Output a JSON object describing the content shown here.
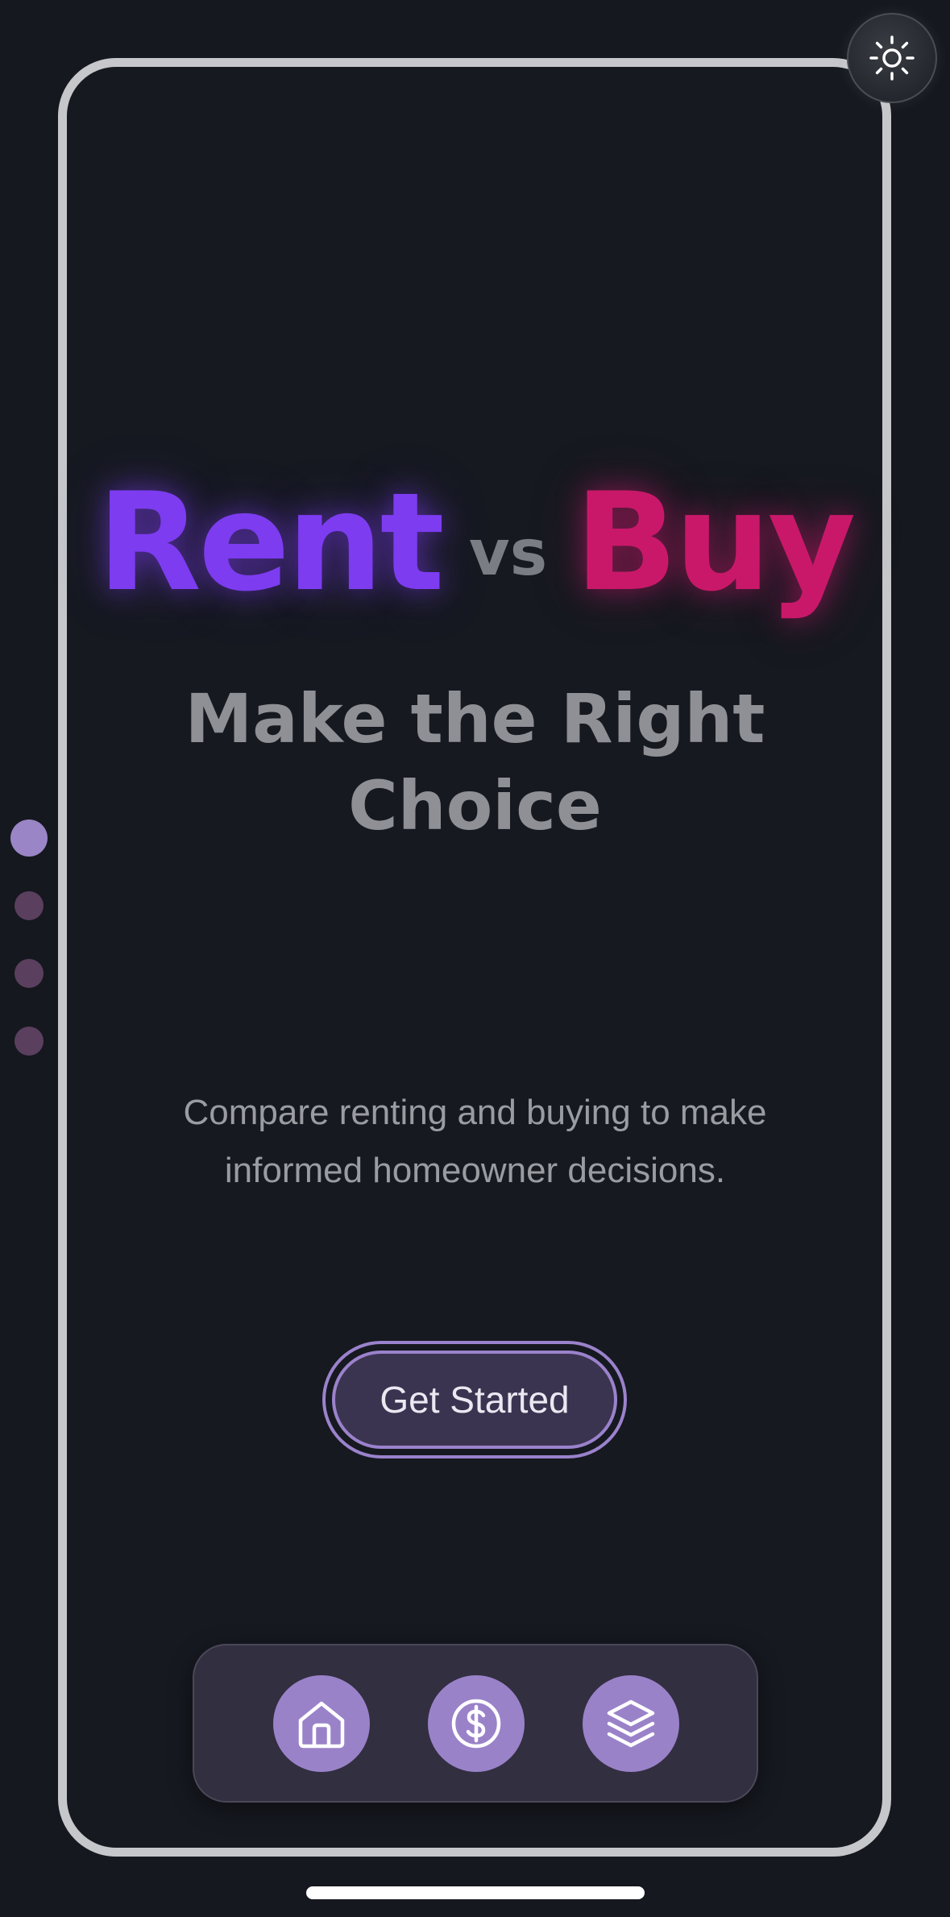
{
  "hero": {
    "word_rent": "Rent",
    "word_vs": "vs",
    "word_buy": "Buy",
    "subtitle": "Make the Right Choice"
  },
  "description": "Compare renting and buying to make informed homeowner decisions.",
  "cta": {
    "label": "Get Started"
  },
  "theme_toggle": {
    "icon": "sun-icon"
  },
  "pagination": {
    "total": 4,
    "active_index": 0
  },
  "bottom_nav": {
    "items": [
      {
        "icon": "home-icon"
      },
      {
        "icon": "dollar-icon"
      },
      {
        "icon": "layers-icon"
      }
    ]
  },
  "colors": {
    "rent": "#7d3cf0",
    "buy": "#c9186a",
    "accent": "#9a82c9",
    "background": "#161920"
  }
}
